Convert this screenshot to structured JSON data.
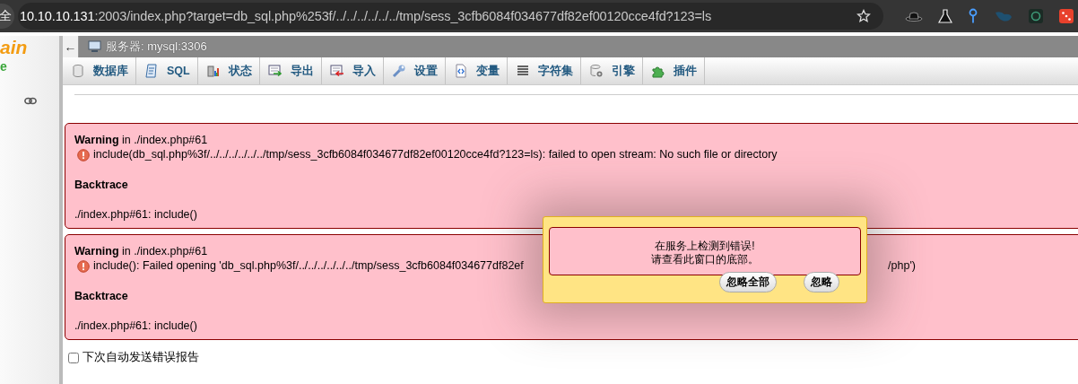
{
  "browser": {
    "menu_button": "全",
    "url_host": "10.10.10.131",
    "url_rest": ":2003/index.php?target=db_sql.php%253f/../../../../../../tmp/sess_3cfb6084f034677df82ef00120cce4fd?123=ls"
  },
  "sidebar": {
    "logo": "ain",
    "logo_sub": "e"
  },
  "server_bar": {
    "back": "←",
    "title": "服务器: mysql:3306"
  },
  "tabs": [
    {
      "label": "数据库",
      "kind": "database",
      "selected": false
    },
    {
      "label": "SQL",
      "kind": "sql",
      "selected": false
    },
    {
      "label": "状态",
      "kind": "status",
      "selected": false
    },
    {
      "label": "导出",
      "kind": "export",
      "selected": false
    },
    {
      "label": "导入",
      "kind": "import",
      "selected": false
    },
    {
      "label": "设置",
      "kind": "settings",
      "selected": false
    },
    {
      "label": "变量",
      "kind": "variables",
      "selected": false
    },
    {
      "label": "字符集",
      "kind": "charset",
      "selected": false
    },
    {
      "label": "引擎",
      "kind": "engine",
      "selected": false
    },
    {
      "label": "插件",
      "kind": "plugin",
      "selected": false
    }
  ],
  "errors": [
    {
      "level": "Warning",
      "location": " in ./index.php#61",
      "message": "include(db_sql.php%3f/../../../../../../tmp/sess_3cfb6084f034677df82ef00120cce4fd?123=ls): failed to open stream: No such file or directory",
      "backtrace_title": "Backtrace",
      "backtrace": "./index.php#61: include()"
    },
    {
      "level": "Warning",
      "location": " in ./index.php#61",
      "message": "include(): Failed opening 'db_sql.php%3f/../../../../../../tmp/sess_3cfb6084f034677df82ef",
      "message_tail": "/php')",
      "backtrace_title": "Backtrace",
      "backtrace": "./index.php#61: include()"
    }
  ],
  "report_checkbox": {
    "label": "下次自动发送错误报告",
    "checked": false
  },
  "popup": {
    "lines": [
      "在服务上检测到错误!",
      "请查看此窗口的底部。"
    ],
    "buttons": [
      "忽略全部",
      "忽略"
    ]
  }
}
